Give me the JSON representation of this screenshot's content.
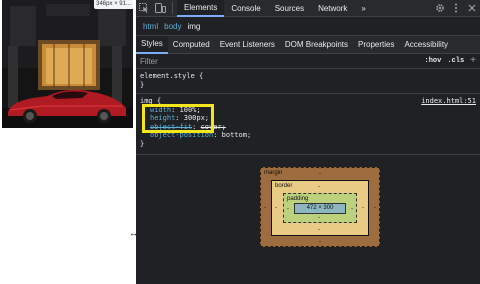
{
  "preview": {
    "size_tooltip": "346px × 91..."
  },
  "devtools": {
    "main_tabs": [
      "Elements",
      "Console",
      "Sources",
      "Network"
    ],
    "more_tabs": "»",
    "breadcrumb": [
      "html",
      "body",
      "img"
    ],
    "sub_tabs": [
      "Styles",
      "Computed",
      "Event Listeners",
      "DOM Breakpoints",
      "Properties",
      "Accessibility"
    ],
    "filter": {
      "placeholder": "Filter",
      "hov": ":hov",
      "cls": ".cls",
      "add": "+"
    },
    "rules": {
      "element_style": {
        "selector": "element.style {",
        "close": "}"
      },
      "img": {
        "selector": "img {",
        "source": "index.html:51",
        "declarations": [
          {
            "prop": "width",
            "value": "100%;"
          },
          {
            "prop": "height",
            "value": "300px;"
          },
          {
            "prop": "object-fit",
            "value": "cover;"
          },
          {
            "prop": "object-position",
            "value": "bottom;"
          }
        ],
        "close": "}"
      }
    },
    "box_model": {
      "margin_label": "margin",
      "border_label": "border",
      "padding_label": "padding",
      "content": "472 × 300",
      "placeholder": "-"
    },
    "icons": {
      "inspect": "cursor-arrow-icon",
      "device": "device-toggle-icon",
      "settings": "gear-icon",
      "more": "vertical-dots-icon",
      "close": "close-icon"
    },
    "colors": {
      "accent": "#7cacf8",
      "highlight": "#f4e61a",
      "margin": "#9d6c3f",
      "border": "#e9cb86",
      "padding": "#bcd17e",
      "content": "#8cb6c0"
    }
  }
}
